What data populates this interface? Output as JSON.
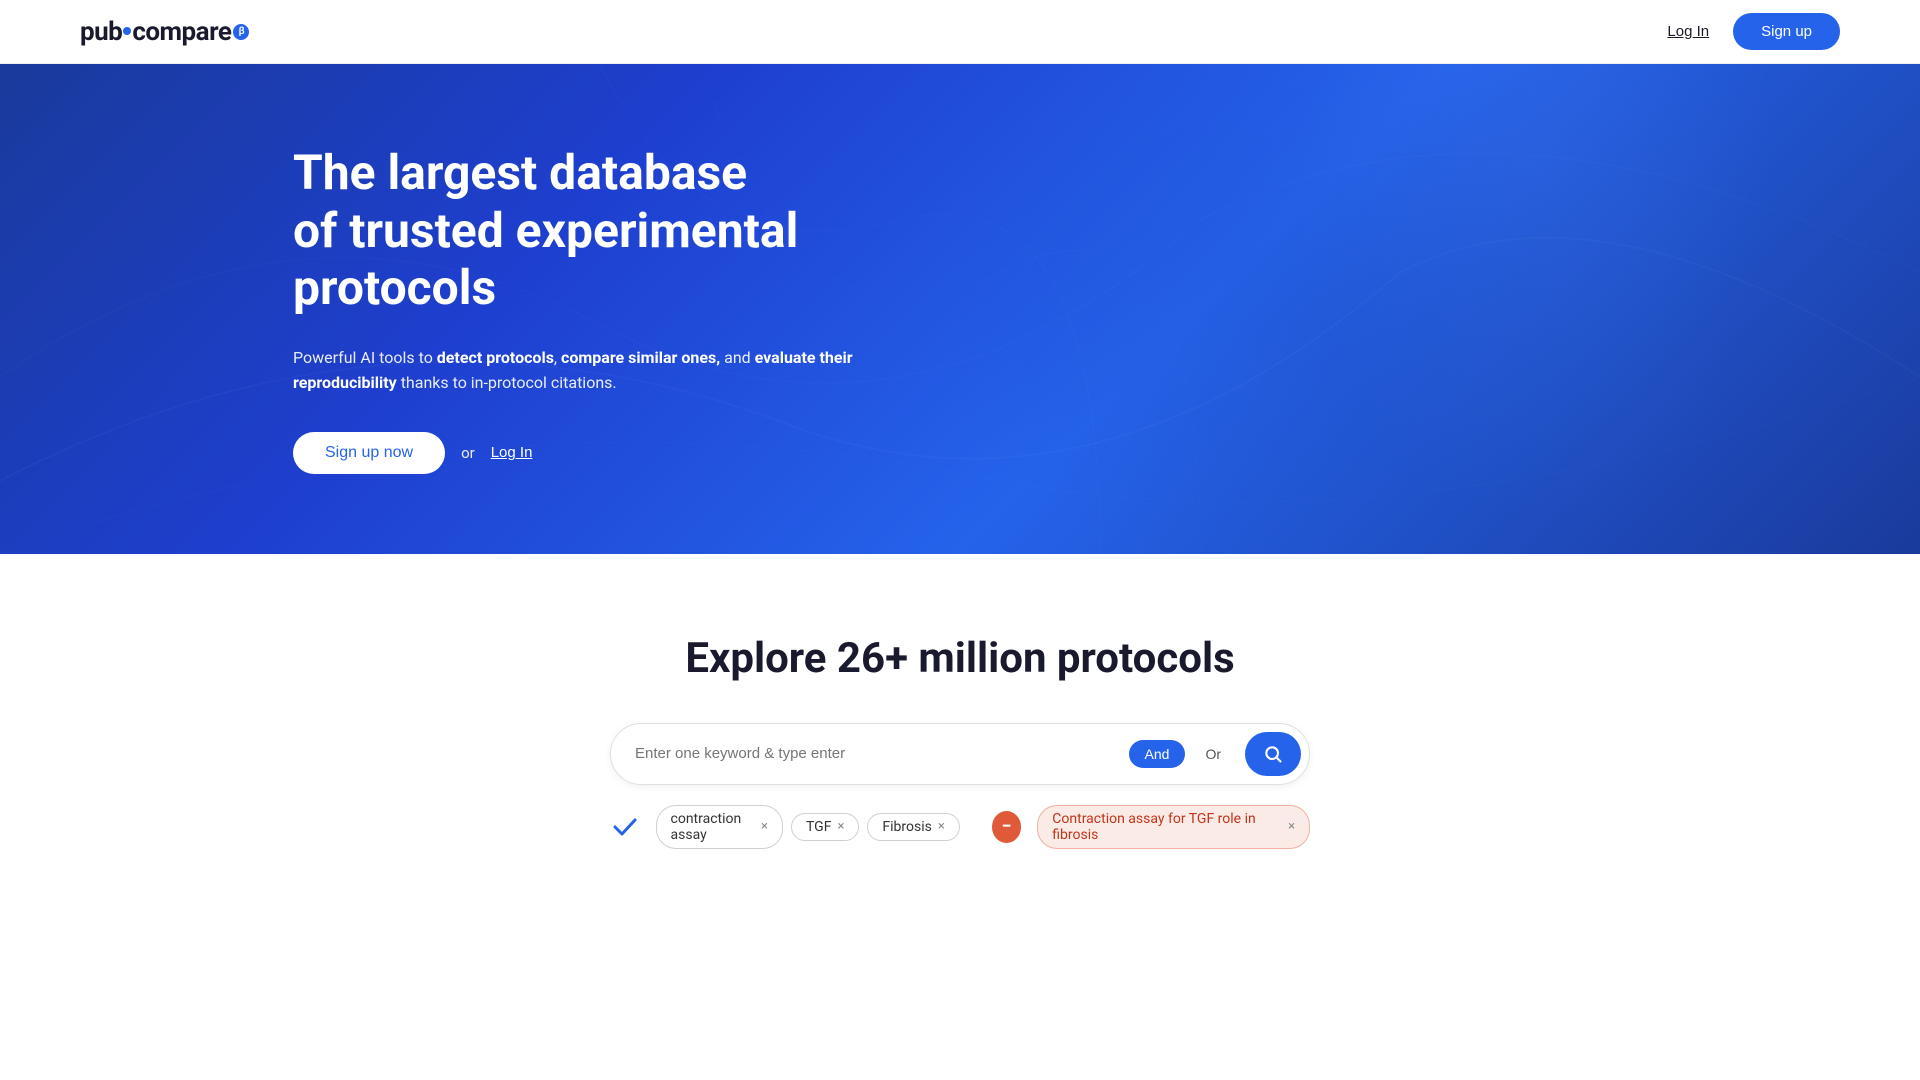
{
  "navbar": {
    "logo": {
      "pub": "pub",
      "compare": "compare",
      "beta_label": "β"
    },
    "login_label": "Log In",
    "signup_label": "Sign up"
  },
  "hero": {
    "title_line1": "The largest database",
    "title_line2": "of trusted experimental protocols",
    "subtitle_prefix": "Powerful AI tools to ",
    "subtitle_bold1": "detect protocols",
    "subtitle_sep1": ", ",
    "subtitle_bold2": "compare similar ones,",
    "subtitle_middle": " and ",
    "subtitle_bold3": "evaluate their reproducibility",
    "subtitle_suffix": " thanks to in-protocol citations.",
    "signup_now_label": "Sign up now",
    "or_label": "or",
    "login_label": "Log In"
  },
  "explore": {
    "title": "Explore 26+ million protocols",
    "search_placeholder": "Enter one keyword & type enter",
    "operator_and": "And",
    "operator_or": "Or",
    "search_button_label": "search",
    "tags_include": [
      {
        "label": "contraction assay",
        "id": "tag-contraction-assay"
      },
      {
        "label": "TGF",
        "id": "tag-tgf"
      },
      {
        "label": "Fibrosis",
        "id": "tag-fibrosis"
      }
    ],
    "tags_exclude": [
      {
        "label": "Contraction assay for TGF role in fibrosis",
        "id": "tag-exclude-1"
      }
    ]
  }
}
